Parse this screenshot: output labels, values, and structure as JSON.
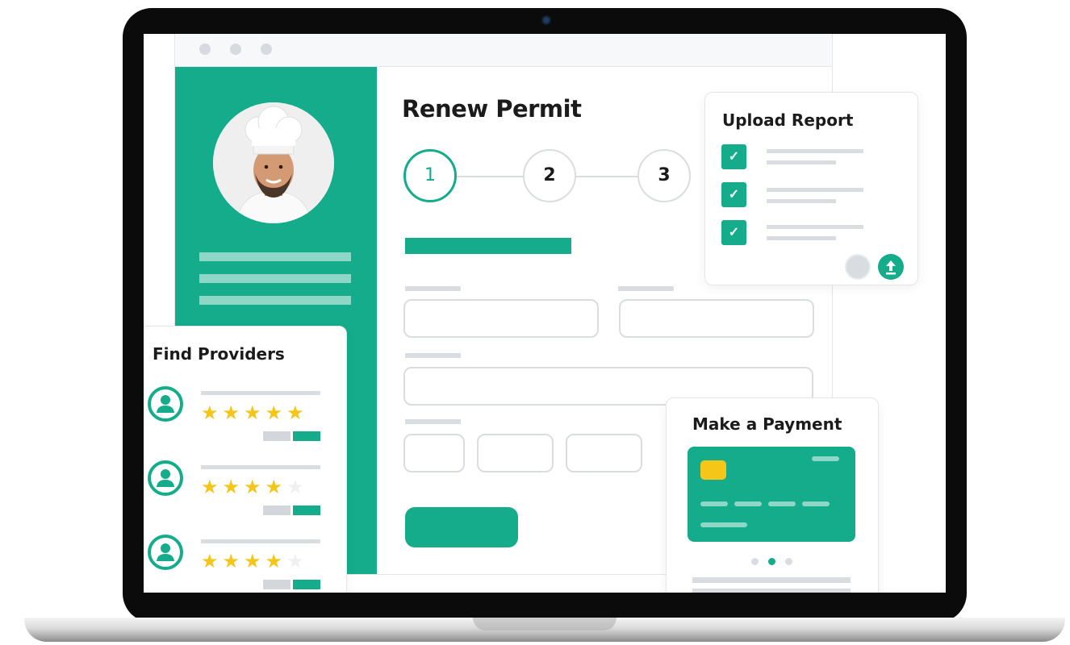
{
  "main": {
    "title": "Renew Permit",
    "steps": [
      "1",
      "2",
      "3"
    ],
    "active_step": 1
  },
  "upload_card": {
    "title": "Upload Report",
    "checklist_checked": [
      true,
      true,
      true
    ],
    "check_icon": "check-icon",
    "action_icons": [
      "circle-icon",
      "upload-icon"
    ]
  },
  "providers_card": {
    "title": "Find Providers",
    "providers": [
      {
        "rating": 5,
        "max": 5
      },
      {
        "rating": 4,
        "max": 5
      },
      {
        "rating": 4,
        "max": 5
      }
    ]
  },
  "payment_card": {
    "title": "Make a Payment",
    "carousel": {
      "count": 3,
      "active": 2
    }
  },
  "colors": {
    "accent": "#14ac8b",
    "accent_light": "#8ed6c5",
    "star": "#f5c518",
    "placeholder": "#d9dde1"
  }
}
